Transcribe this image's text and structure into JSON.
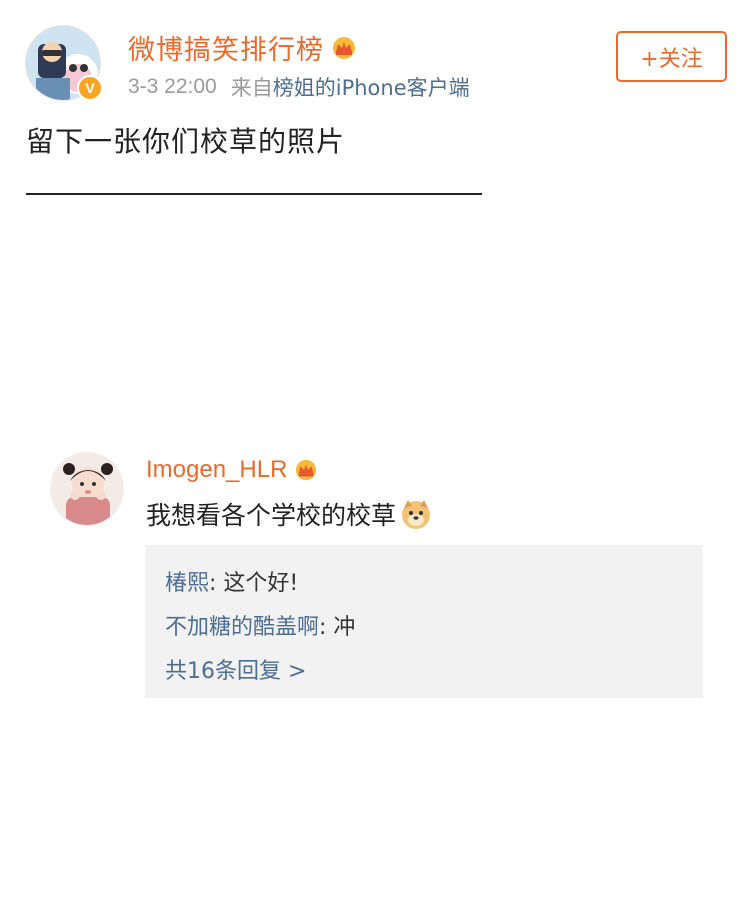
{
  "post": {
    "author": "微博搞笑排行榜",
    "time": "3-3 22:00",
    "source_prefix": "来自",
    "source": "榜姐的iPhone客户端",
    "follow_label": "+关注",
    "verified_badge": "V",
    "text": "留下一张你们校草的照片"
  },
  "comment": {
    "author": "Imogen_HLR",
    "text": "我想看各个学校的校草",
    "replies": [
      {
        "name": "椿熙",
        "sep": ": ",
        "text": "这个好!"
      },
      {
        "name": "不加糖的酷盖啊",
        "sep": ": ",
        "text": "冲"
      }
    ],
    "more_replies": "共16条回复 >"
  },
  "colors": {
    "accent": "#ea6a2b",
    "link": "#4e6d93",
    "reply_bg": "#f2f2f2"
  },
  "icons": {
    "crown": "crown-icon",
    "verified": "verified-badge-icon",
    "doge": "doge-emoji-icon"
  }
}
